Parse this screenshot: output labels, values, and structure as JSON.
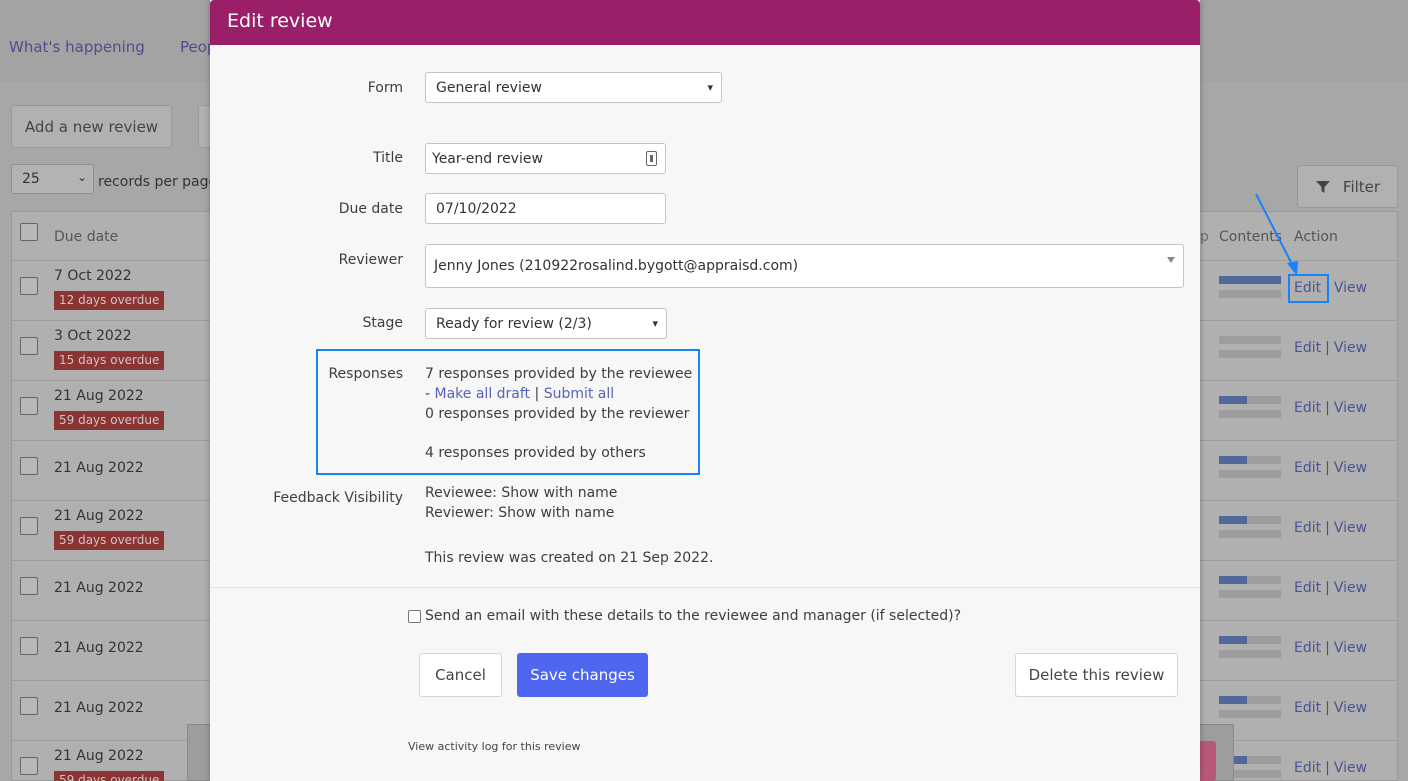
{
  "background": {
    "nav": [
      "What's happening",
      "Peop"
    ],
    "add_review_label": "Add a new review",
    "records_value": "25",
    "records_label": "records per page",
    "filter_label": "Filter",
    "headers": {
      "due_date": "Due date",
      "contents": "Contents",
      "action": "Action"
    },
    "edit_label": "Edit",
    "view_label": "View",
    "rows": [
      {
        "date": "7 Oct 2022",
        "overdue": "12 days overdue",
        "progress": 1.0
      },
      {
        "date": "3 Oct 2022",
        "overdue": "15 days overdue",
        "progress": 0.0
      },
      {
        "date": "21 Aug 2022",
        "overdue": "59 days overdue",
        "progress": 0.45
      },
      {
        "date": "21 Aug 2022",
        "overdue": "",
        "progress": 0.45
      },
      {
        "date": "21 Aug 2022",
        "overdue": "59 days overdue",
        "progress": 0.45
      },
      {
        "date": "21 Aug 2022",
        "overdue": "",
        "progress": 0.45
      },
      {
        "date": "21 Aug 2022",
        "overdue": "",
        "progress": 0.45
      },
      {
        "date": "21 Aug 2022",
        "overdue": "",
        "progress": 0.45
      },
      {
        "date": "21 Aug 2022",
        "overdue": "59 days overdue",
        "progress": 0.45
      }
    ]
  },
  "modal": {
    "title": "Edit review",
    "form": {
      "label": "Form",
      "value": "General review"
    },
    "title_field": {
      "label": "Title",
      "value": "Year-end review"
    },
    "due_date": {
      "label": "Due date",
      "value": "07/10/2022"
    },
    "reviewer": {
      "label": "Reviewer",
      "value": "Jenny Jones (210922rosalind.bygott@appraisd.com)"
    },
    "stage": {
      "label": "Stage",
      "value": "Ready for review (2/3)"
    },
    "responses": {
      "label": "Responses",
      "reviewee": "7 responses provided by the reviewee",
      "dash": "- ",
      "make_all_draft": "Make all draft",
      "pipe": " | ",
      "submit_all": "Submit all",
      "reviewer": "0 responses provided by the reviewer",
      "others": "4 responses provided by others"
    },
    "visibility": {
      "label": "Feedback Visibility",
      "reviewee": "Reviewee: Show with name",
      "reviewer": "Reviewer: Show with name"
    },
    "created": "This review was created on 21 Sep 2022.",
    "email_label": "Send an email with these details to the reviewee and manager (if selected)?",
    "cancel_label": "Cancel",
    "save_label": "Save changes",
    "delete_label": "Delete this review",
    "activity_label": "View activity log for this review"
  },
  "colors": {
    "header": "#9b1f68",
    "primary": "#4f67f0",
    "annotation": "#1a82f7"
  }
}
